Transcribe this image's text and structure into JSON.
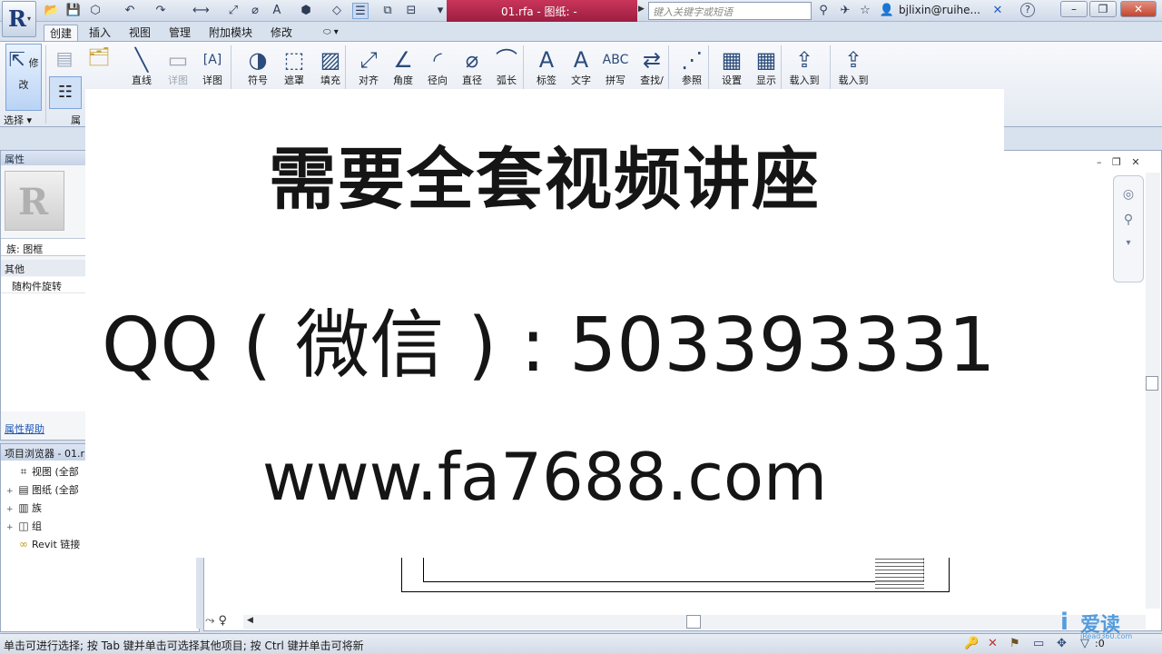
{
  "titlebar": {
    "document_title": "01.rfa - 图纸: -",
    "search_placeholder": "键入关键字或短语",
    "user": "bjlixin@ruihe...",
    "help": "?",
    "minimize": "–",
    "restore": "❐",
    "close": "✕"
  },
  "ribbon_tabs": [
    "创建",
    "插入",
    "视图",
    "管理",
    "附加模块",
    "修改"
  ],
  "ribbon": {
    "modify_label": "修改",
    "select_label": "选择 ▾",
    "panel_cut_label": "属",
    "buttons": [
      {
        "label": "直线",
        "icon": "line-icon",
        "glyph": "╲"
      },
      {
        "label": "详图",
        "icon": "detail-component-icon",
        "glyph": "▭"
      },
      {
        "label": "详图",
        "icon": "detail-group-icon",
        "glyph": "[A]"
      },
      {
        "label": "符号",
        "icon": "symbol-icon",
        "glyph": "◑"
      },
      {
        "label": "遮罩",
        "icon": "masking-region-icon",
        "glyph": "⬚"
      },
      {
        "label": "填充",
        "icon": "filled-region-icon",
        "glyph": "▨"
      },
      {
        "label": "对齐",
        "icon": "aligned-dimension-icon",
        "glyph": "⤢"
      },
      {
        "label": "角度",
        "icon": "angular-dimension-icon",
        "glyph": "∠"
      },
      {
        "label": "径向",
        "icon": "radial-dimension-icon",
        "glyph": "◜"
      },
      {
        "label": "直径",
        "icon": "diameter-dimension-icon",
        "glyph": "⌀"
      },
      {
        "label": "弧长",
        "icon": "arc-length-icon",
        "glyph": "⌒"
      },
      {
        "label": "标签",
        "icon": "label-icon",
        "glyph": "A"
      },
      {
        "label": "文字",
        "icon": "text-icon",
        "glyph": "A"
      },
      {
        "label": "拼写",
        "icon": "spelling-icon",
        "glyph": "ABC"
      },
      {
        "label": "查找/",
        "icon": "find-replace-icon",
        "glyph": "⇄"
      },
      {
        "label": "参照",
        "icon": "reference-line-icon",
        "glyph": "⋰"
      },
      {
        "label": "设置",
        "icon": "set-workplane-icon",
        "glyph": "▦"
      },
      {
        "label": "显示",
        "icon": "show-workplane-icon",
        "glyph": "▦"
      },
      {
        "label": "载入到",
        "icon": "load-into-project-icon",
        "glyph": "⇪"
      },
      {
        "label": "载入到",
        "icon": "load-into-project-close-icon",
        "glyph": "⇪"
      }
    ]
  },
  "properties": {
    "header": "属性",
    "family": "族: 图框",
    "group": "其他",
    "row": "随构件旋转",
    "help_link": "属性帮助"
  },
  "browser": {
    "header": "项目浏览器 - 01.r",
    "items": [
      {
        "pm": "",
        "label": "视图 (全部"
      },
      {
        "pm": "+",
        "label": "图纸 (全部"
      },
      {
        "pm": "+",
        "label": "族"
      },
      {
        "pm": "+",
        "label": "组"
      },
      {
        "pm": "",
        "label": "Revit 链接"
      }
    ]
  },
  "promo": {
    "line1": "需要全套视频讲座",
    "line2": "QQ ( 微信 ) : 503393331",
    "line3": "www.fa7688.com"
  },
  "canvas_controls": "– ❐ ✕",
  "status": {
    "text": "单击可进行选择; 按 Tab 键并单击可选择其他项目; 按 Ctrl 键并单击可将新",
    "filter_count": ":0"
  },
  "brand": {
    "logo": "iD",
    "name": "爱读",
    "sub": "iRead360.com"
  }
}
